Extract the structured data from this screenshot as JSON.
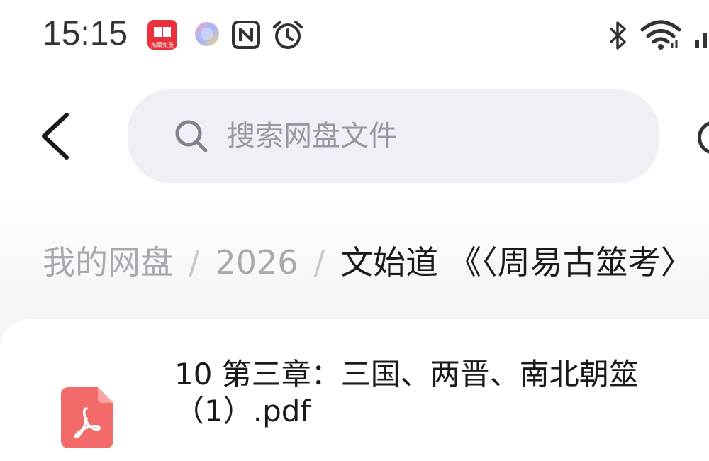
{
  "status_bar": {
    "time": "15:15",
    "left_icons": [
      "red-app-icon",
      "ai-assistant-icon",
      "nfc-icon",
      "alarm-icon"
    ],
    "right_icons": [
      "bluetooth-icon",
      "wifi-icon",
      "signal-icon"
    ],
    "red_app_icon_text": "淘菜免费"
  },
  "header": {
    "back_icon": "chevron-left-icon",
    "search_placeholder": "搜索网盘文件"
  },
  "breadcrumb": {
    "items": [
      "我的网盘",
      "2026",
      "文始道 《〈周易古筮考〉"
    ],
    "separator": "/"
  },
  "files": [
    {
      "name_line1": "10 第三章：三国、两晋、南北朝筮",
      "name_line2": "（1）.pdf",
      "icon": "pdf-file-icon"
    }
  ],
  "colors": {
    "search_bg": "#eef0f5",
    "pdf_red": "#f26a6a",
    "muted_text": "#a6a9b0"
  }
}
